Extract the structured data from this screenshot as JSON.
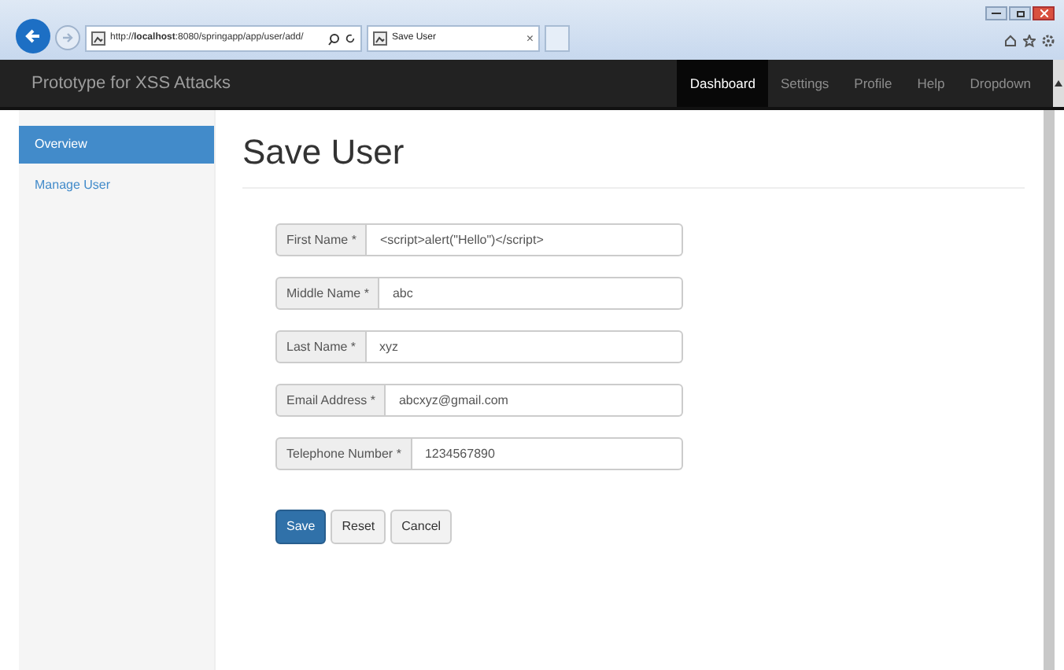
{
  "browser": {
    "address": "http://**localhost**:8080/springapp/app/user/add/",
    "tab_title": "Save User",
    "tab_close": "×"
  },
  "navbar": {
    "brand": "Prototype for XSS Attacks",
    "items": [
      {
        "label": "Dashboard",
        "selected": true
      },
      {
        "label": "Settings",
        "selected": false
      },
      {
        "label": "Profile",
        "selected": false
      },
      {
        "label": "Help",
        "selected": false
      },
      {
        "label": "Dropdown",
        "selected": false
      }
    ]
  },
  "sidebar": {
    "items": [
      {
        "label": "Overview",
        "selected": true
      },
      {
        "label": "Manage User",
        "selected": false
      }
    ]
  },
  "page_title": "Save User",
  "form": {
    "fields": [
      {
        "label": "First Name *",
        "value": "<script>alert(\"Hello\")</script>"
      },
      {
        "label": "Middle Name *",
        "value": "abc"
      },
      {
        "label": "Last Name *",
        "value": "xyz"
      },
      {
        "label": "Email Address *",
        "value": "abcxyz@gmail.com"
      },
      {
        "label": "Telephone Number *",
        "value": "1234567890"
      }
    ],
    "buttons": [
      {
        "label": "Save",
        "kind": "primary"
      },
      {
        "label": "Reset",
        "kind": "default"
      },
      {
        "label": "Cancel",
        "kind": "default"
      }
    ]
  }
}
